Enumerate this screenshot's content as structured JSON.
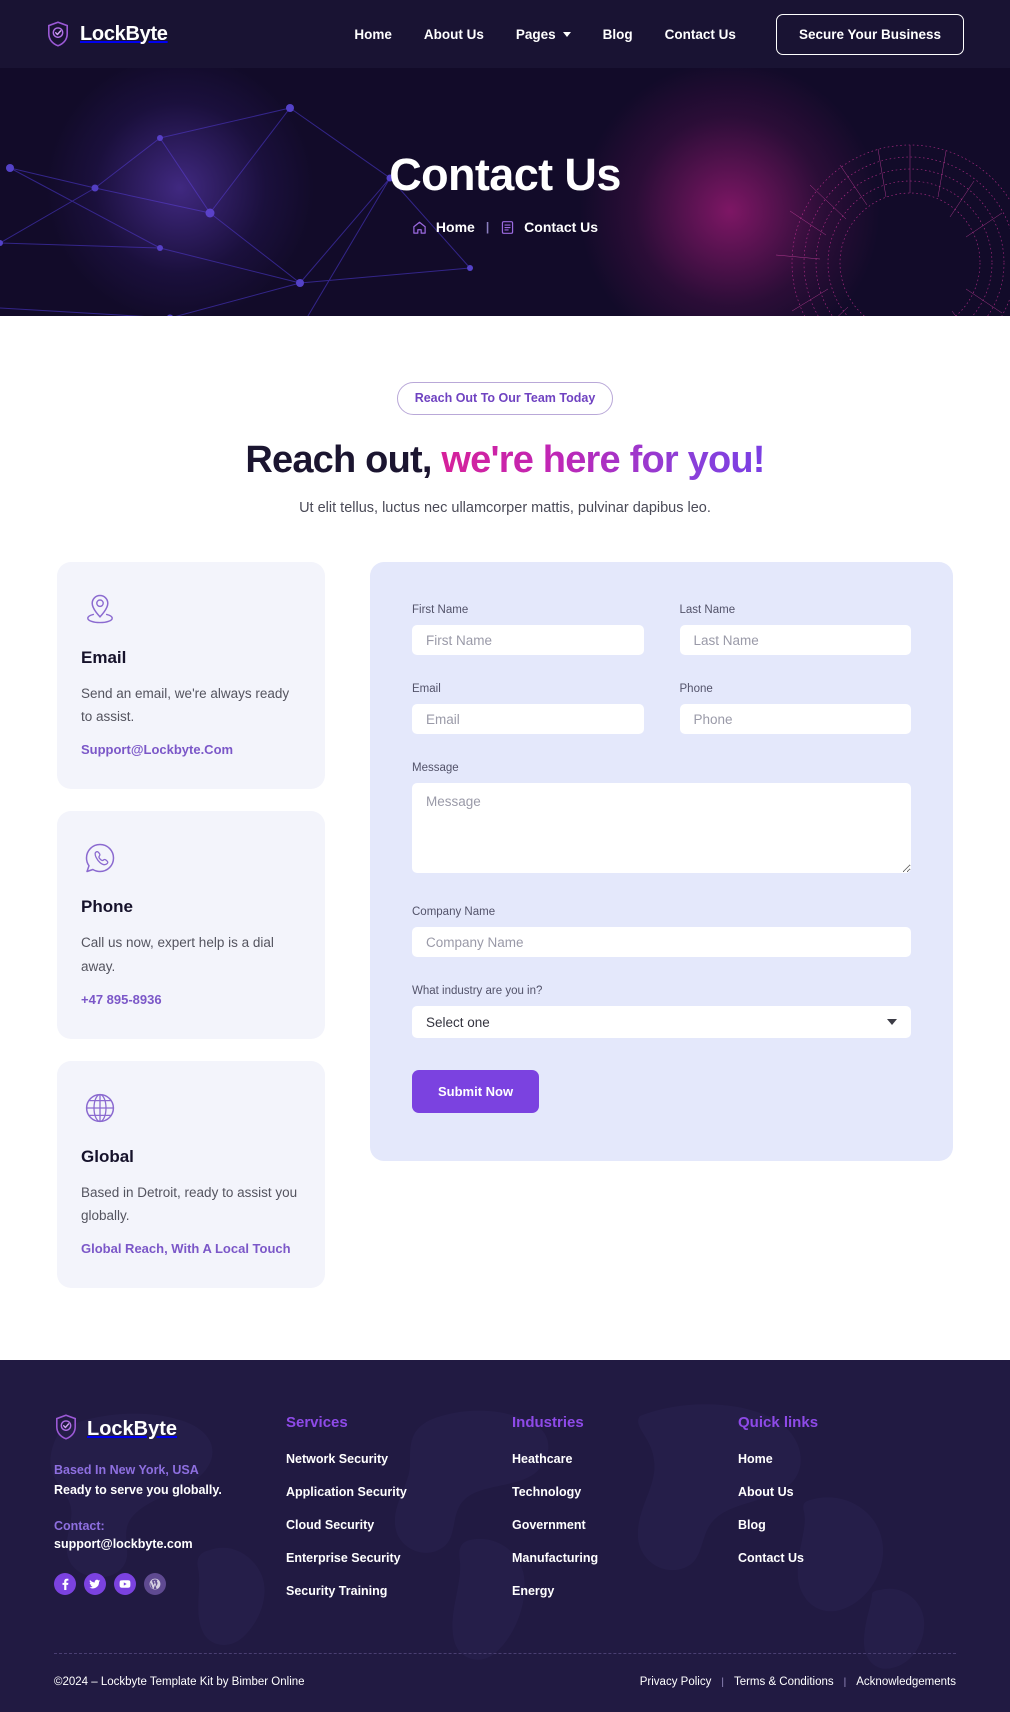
{
  "header": {
    "brand": "LockByte",
    "nav": [
      {
        "label": "Home",
        "has_caret": false
      },
      {
        "label": "About Us",
        "has_caret": false
      },
      {
        "label": "Pages",
        "has_caret": true
      },
      {
        "label": "Blog",
        "has_caret": false
      },
      {
        "label": "Contact Us",
        "has_caret": false
      }
    ],
    "cta": "Secure Your Business"
  },
  "hero": {
    "title": "Contact Us",
    "breadcrumb": {
      "home": "Home",
      "separator": "|",
      "current": "Contact Us"
    }
  },
  "section": {
    "pill": "Reach Out To Our Team Today",
    "title_dark": "Reach out,",
    "title_gradient": "we're here for you!",
    "subtitle": "Ut elit tellus, luctus nec ullamcorper mattis, pulvinar dapibus leo."
  },
  "cards": [
    {
      "icon": "location-pin-icon",
      "title": "Email",
      "text": "Send an email, we're always ready to assist.",
      "link": "Support@Lockbyte.Com"
    },
    {
      "icon": "phone-call-icon",
      "title": "Phone",
      "text": "Call us now, expert help is a dial away.",
      "link": "+47 895-8936"
    },
    {
      "icon": "globe-icon",
      "title": "Global",
      "text": "Based in Detroit, ready to assist you globally.",
      "link": "Global Reach, With A Local Touch"
    }
  ],
  "form": {
    "first_name": {
      "label": "First Name",
      "placeholder": "First Name",
      "value": ""
    },
    "last_name": {
      "label": "Last Name",
      "placeholder": "Last Name",
      "value": ""
    },
    "email": {
      "label": "Email",
      "placeholder": "Email",
      "value": ""
    },
    "phone": {
      "label": "Phone",
      "placeholder": "Phone",
      "value": ""
    },
    "message": {
      "label": "Message",
      "placeholder": "Message",
      "value": ""
    },
    "company": {
      "label": "Company Name",
      "placeholder": "Company Name",
      "value": ""
    },
    "industry": {
      "label": "What industry are you in?",
      "selected": "Select one",
      "options": [
        "Select one"
      ]
    },
    "submit": "Submit Now"
  },
  "footer": {
    "brand": "LockByte",
    "location": "Based In New York, USA",
    "tagline": "Ready to serve you globally.",
    "contact_label": "Contact:",
    "contact_email": "support@lockbyte.com",
    "socials": [
      {
        "name": "facebook-icon",
        "muted": false
      },
      {
        "name": "twitter-icon",
        "muted": false
      },
      {
        "name": "youtube-icon",
        "muted": false
      },
      {
        "name": "wordpress-icon",
        "muted": true
      }
    ],
    "columns": [
      {
        "title": "Services",
        "links": [
          "Network Security",
          "Application Security",
          "Cloud Security",
          "Enterprise Security",
          "Security Training"
        ]
      },
      {
        "title": "Industries",
        "links": [
          "Heathcare",
          "Technology",
          "Government",
          "Manufacturing",
          "Energy"
        ]
      },
      {
        "title": "Quick links",
        "links": [
          "Home",
          "About Us",
          "Blog",
          "Contact Us"
        ]
      }
    ],
    "copyright": "©2024 – Lockbyte Template Kit by Bimber Online",
    "legal": [
      "Privacy Policy",
      "Terms & Conditions",
      "Acknowledgements"
    ],
    "legal_separator": "|"
  },
  "colors": {
    "accent_purple": "#7b42e0",
    "header_bg": "#191333",
    "hero_bg": "#120b29",
    "footer_bg": "#211a42",
    "form_bg": "#e4e8fb",
    "card_bg": "#f3f4fb",
    "link_purple": "#7b57c8",
    "gradient_start": "#d6219a",
    "gradient_end": "#7b3fe4"
  }
}
